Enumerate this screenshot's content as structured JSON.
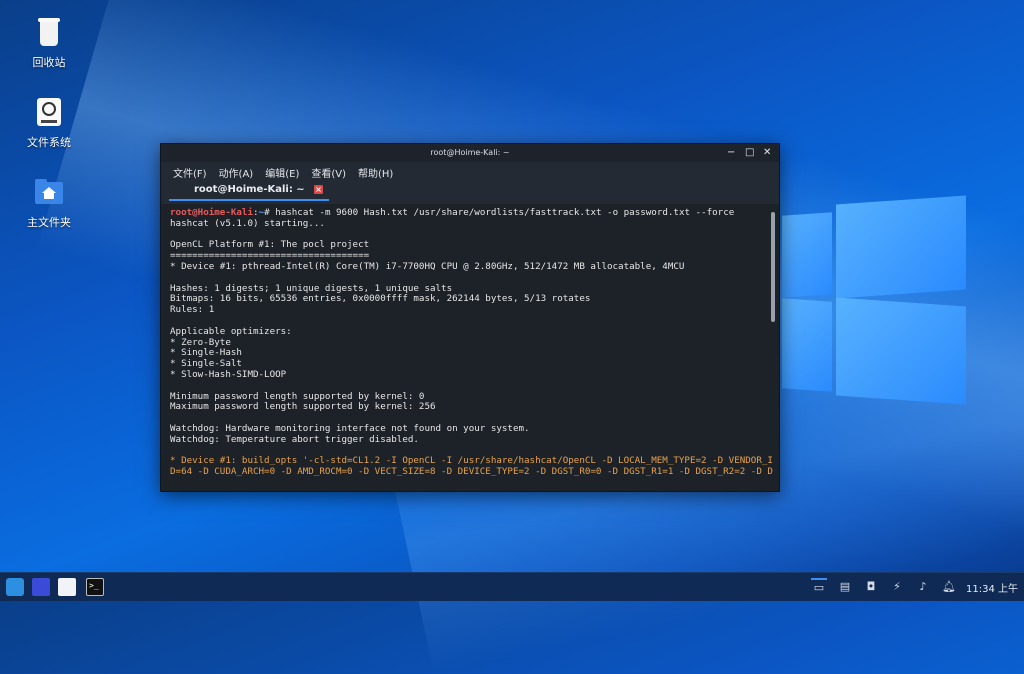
{
  "desktop": {
    "icons": [
      {
        "label": "回收站",
        "icon": "trash-icon"
      },
      {
        "label": "文件系统",
        "icon": "drive-icon"
      },
      {
        "label": "主文件夹",
        "icon": "home-folder-icon"
      }
    ]
  },
  "terminal": {
    "window_title": "root@Hoime-Kali: ~",
    "controls": {
      "minimize": "−",
      "maximize": "□",
      "close": "✕"
    },
    "menu": [
      "文件(F)",
      "动作(A)",
      "编辑(E)",
      "查看(V)",
      "帮助(H)"
    ],
    "tab_label": "root@Hoime-Kali: ~",
    "prompt": {
      "user": "root@Hoime-Kali",
      "sep": ":",
      "path": "~",
      "symbol": "# "
    },
    "command": "hashcat -m 9600 Hash.txt /usr/share/wordlists/fasttrack.txt -o password.txt --force",
    "output": [
      "hashcat (v5.1.0) starting...",
      "",
      "OpenCL Platform #1: The pocl project",
      "====================================",
      "* Device #1: pthread-Intel(R) Core(TM) i7-7700HQ CPU @ 2.80GHz, 512/1472 MB allocatable, 4MCU",
      "",
      "Hashes: 1 digests; 1 unique digests, 1 unique salts",
      "Bitmaps: 16 bits, 65536 entries, 0x0000ffff mask, 262144 bytes, 5/13 rotates",
      "Rules: 1",
      "",
      "Applicable optimizers:",
      "* Zero-Byte",
      "* Single-Hash",
      "* Single-Salt",
      "* Slow-Hash-SIMD-LOOP",
      "",
      "Minimum password length supported by kernel: 0",
      "Maximum password length supported by kernel: 256",
      "",
      "Watchdog: Hardware monitoring interface not found on your system.",
      "Watchdog: Temperature abort trigger disabled.",
      ""
    ],
    "warning_lines": [
      "* Device #1: build_opts '-cl-std=CL1.2 -I OpenCL -I /usr/share/hashcat/OpenCL -D LOCAL_MEM_TYPE=2 -D VENDOR_I",
      "D=64 -D CUDA_ARCH=0 -D AMD_ROCM=0 -D VECT_SIZE=8 -D DEVICE_TYPE=2 -D DGST_R0=0 -D DGST_R1=1 -D DGST_R2=2 -D D"
    ]
  },
  "taskbar": {
    "apps": [
      "kali-menu-icon",
      "screenshot-icon",
      "file-manager-icon",
      "terminal-icon"
    ],
    "tray": [
      "show-desktop-icon",
      "keyboard-icon",
      "network-icon",
      "power-icon",
      "volume-icon",
      "notification-icon"
    ],
    "clock": "11:34 上午"
  },
  "colors": {
    "prompt_user": "#e85a5a",
    "prompt_path": "#5a9cf2",
    "warning": "#e8a24a",
    "tab_accent": "#3d8ff2"
  }
}
